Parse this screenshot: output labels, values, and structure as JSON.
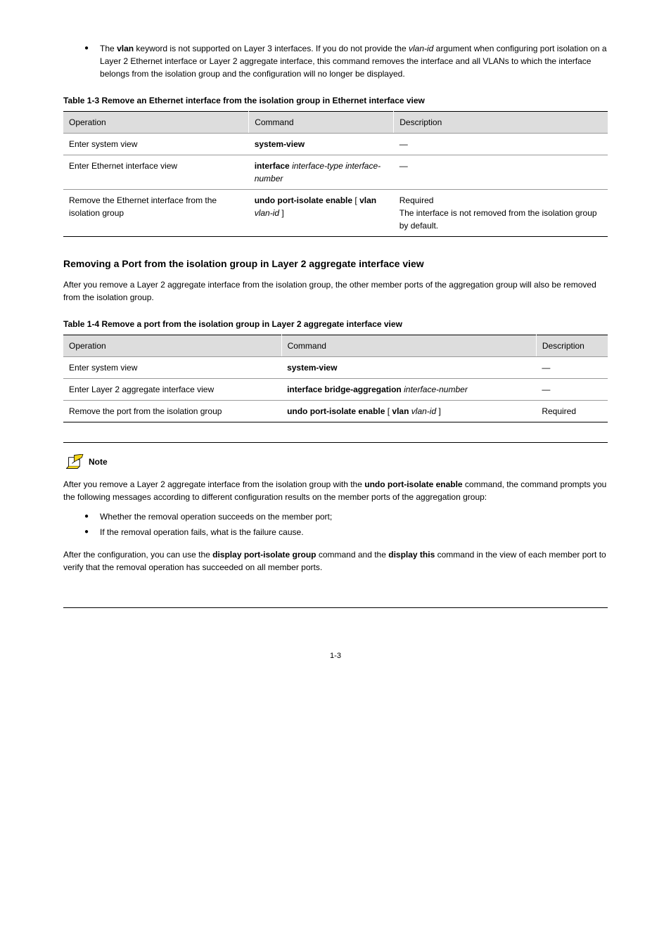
{
  "topBullet": {
    "prefix": "The ",
    "bold1": "vlan",
    "middle": " keyword is not supported on Layer 3 interfaces. If you do not provide the ",
    "italic": "vlan-id",
    "suffix": " argument when configuring port isolation on a Layer 2 Ethernet interface or Layer 2 aggregate interface, this command removes the interface and all VLANs to which the interface belongs from the isolation group and the configuration will no longer be displayed."
  },
  "table1": {
    "caption": "Table 1-3 Remove an Ethernet interface from the isolation group in Ethernet interface view",
    "headers": [
      "Operation",
      "Command",
      "Description"
    ],
    "rows": [
      {
        "op": "Enter system view",
        "cmd": "system-view",
        "desc": "—"
      },
      {
        "op": "Enter Ethernet interface view",
        "cmd_prefix": "interface",
        "cmd_italic": " interface-type interface-number",
        "desc": "—"
      },
      {
        "op": "Remove the Ethernet interface from the isolation group",
        "cmd_prefix": "undo port-isolate enable",
        "cmd_mid": " [ ",
        "cmd_bold2": "vlan",
        "cmd_italic2": " vlan-id",
        "cmd_end": " ]",
        "desc": "Required",
        "desc2": "The interface is not removed from the isolation group by default."
      }
    ]
  },
  "section2Heading": "Removing a Port from the isolation group in Layer 2 aggregate interface view",
  "section2Para": "After you remove a Layer 2 aggregate interface from the isolation group, the other member ports of the aggregation group will also be removed from the isolation group.",
  "table2": {
    "caption": "Table 1-4 Remove a port from the isolation group in Layer 2 aggregate interface view",
    "headers": [
      "Operation",
      "Command",
      "Description"
    ],
    "rows": [
      {
        "op": "Enter system view",
        "cmd": "system-view",
        "desc": "—"
      },
      {
        "op": "Enter Layer 2 aggregate interface view",
        "cmd_prefix": "interface bridge-aggregation",
        "cmd_italic": " interface-number",
        "desc": "—"
      },
      {
        "op": "Remove the port from the isolation group",
        "cmd_prefix": "undo port-isolate enable",
        "cmd_mid": " [ ",
        "cmd_bold2": "vlan",
        "cmd_italic2": " vlan-id",
        "cmd_end": " ]",
        "desc": "Required"
      }
    ]
  },
  "note": {
    "label": "Note",
    "body_prefix": "After you remove a Layer 2 aggregate interface from the isolation group with the ",
    "body_bold": "undo port-isolate enable",
    "body_suffix": " command, the command prompts you the following messages according to different configuration results on the member ports of the aggregation group:",
    "bullets": [
      "Whether the removal operation succeeds on the member port;",
      "If the removal operation fails, what is the failure cause."
    ],
    "post_prefix": "After the configuration, you can use the ",
    "post_bold1": "display port-isolate group",
    "post_mid1": " command and the ",
    "post_bold2": "display this",
    "post_suffix": " command in the view of each member port to verify that the removal operation has succeeded on all member ports."
  },
  "pageNumber": "1-3"
}
